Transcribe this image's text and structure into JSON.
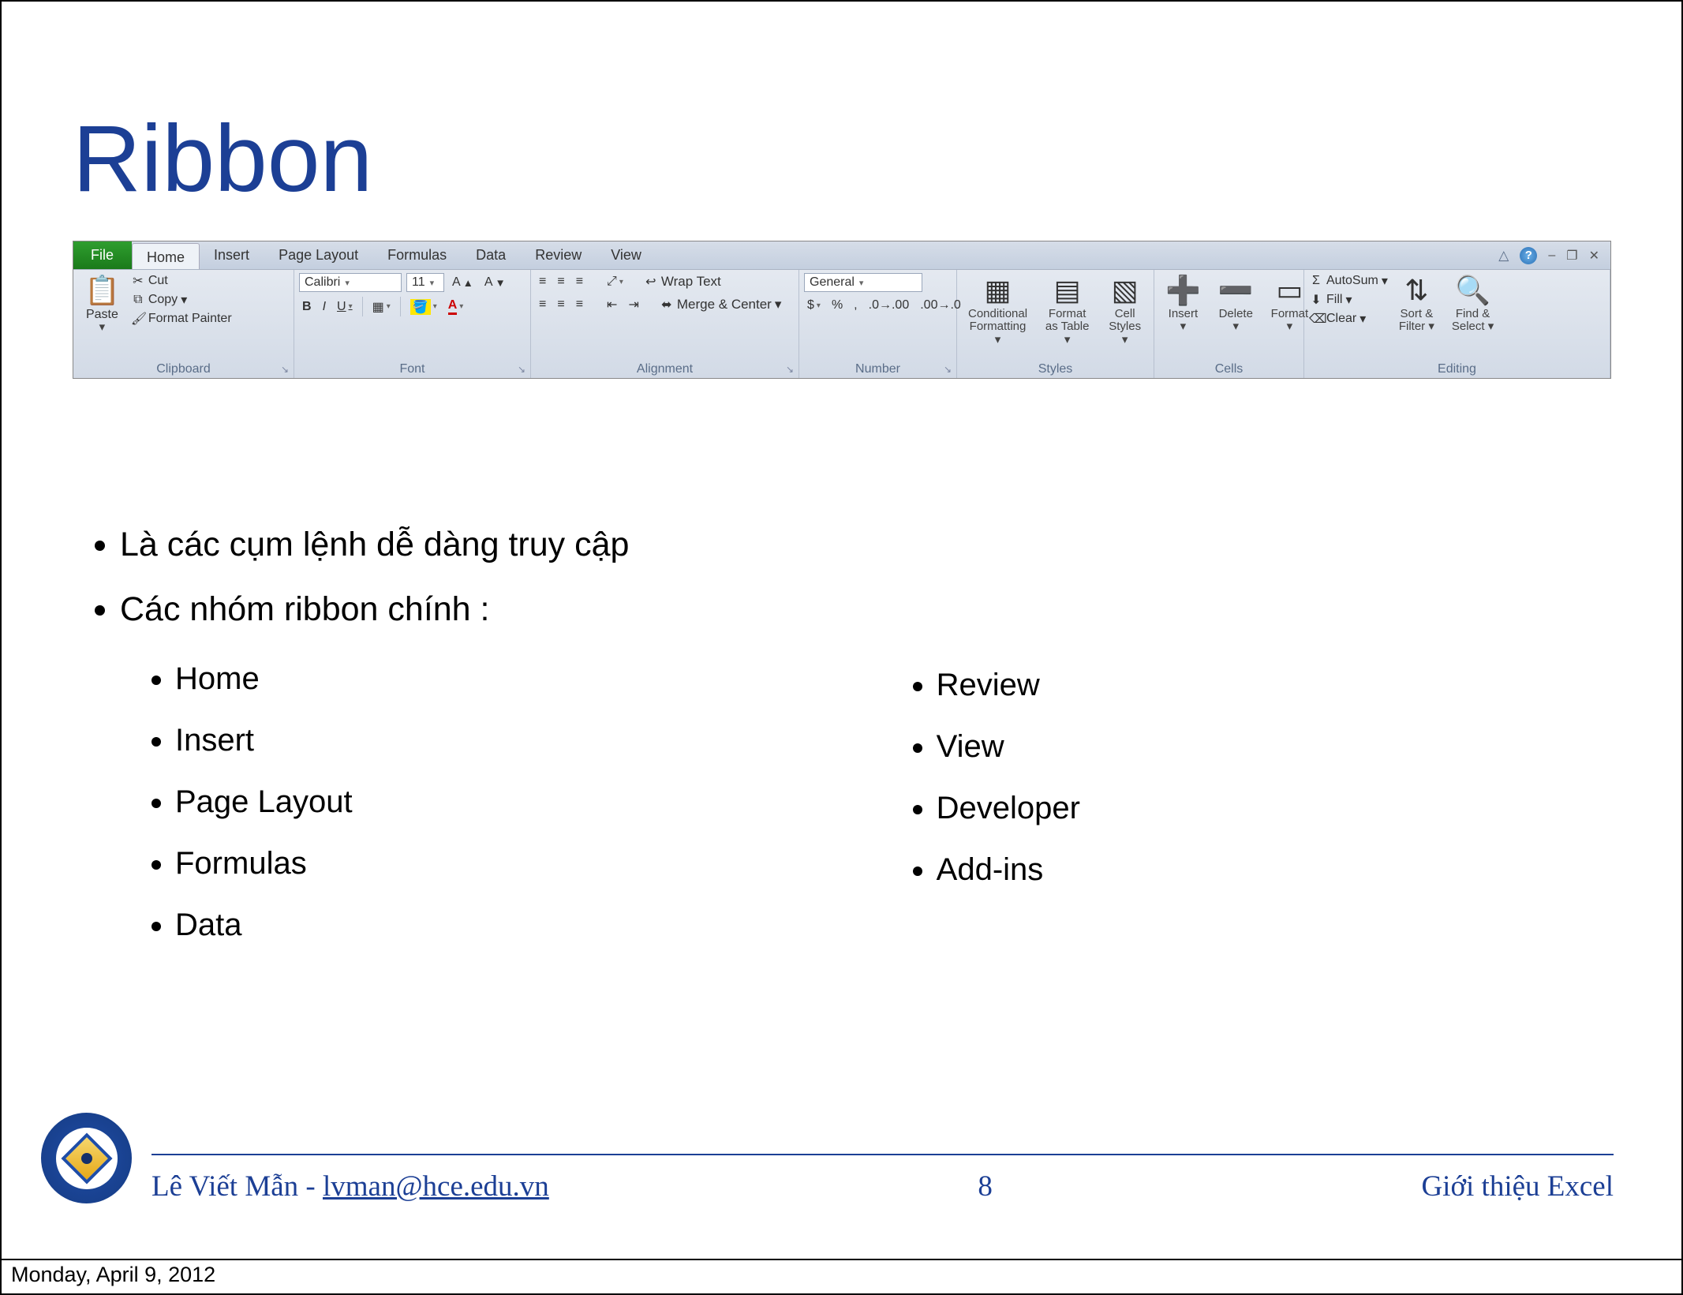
{
  "title": "Ribbon",
  "ribbon": {
    "tabs": {
      "file": "File",
      "home": "Home",
      "insert": "Insert",
      "page_layout": "Page Layout",
      "formulas": "Formulas",
      "data": "Data",
      "review": "Review",
      "view": "View"
    },
    "clipboard": {
      "paste": "Paste",
      "cut": "Cut",
      "copy": "Copy",
      "format_painter": "Format Painter",
      "label": "Clipboard"
    },
    "font": {
      "name": "Calibri",
      "size": "11",
      "bold": "B",
      "italic": "I",
      "underline": "U",
      "increase": "A ▲",
      "decrease": "A ▼",
      "label": "Font"
    },
    "alignment": {
      "wrap": "Wrap Text",
      "merge": "Merge & Center",
      "label": "Alignment"
    },
    "number": {
      "format": "General",
      "currency": "$",
      "percent": "%",
      "comma": ",",
      "inc_dec": ".0",
      "dec_inc": ".00",
      "label": "Number"
    },
    "styles": {
      "cond": "Conditional Formatting",
      "table": "Format as Table",
      "cell": "Cell Styles",
      "label": "Styles"
    },
    "cells": {
      "insert": "Insert",
      "delete": "Delete",
      "format": "Format",
      "label": "Cells"
    },
    "editing": {
      "autosum": "AutoSum",
      "fill": "Fill",
      "clear": "Clear",
      "sort": "Sort & Filter",
      "find": "Find & Select",
      "label": "Editing"
    }
  },
  "bullets": {
    "b1": "Là các cụm lệnh dễ dàng truy cập",
    "b2": "Các nhóm ribbon chính :",
    "col1": {
      "i0": "Home",
      "i1": "Insert",
      "i2": "Page Layout",
      "i3": "Formulas",
      "i4": "Data"
    },
    "col2": {
      "i0": "Review",
      "i1": "View",
      "i2": "Developer",
      "i3": "Add-ins"
    }
  },
  "footer": {
    "author": "Lê Viết Mẫn - ",
    "email": "lvman@hce.edu.vn",
    "page": "8",
    "topic": "Giới thiệu Excel"
  },
  "date": "Monday, April 9, 2012"
}
